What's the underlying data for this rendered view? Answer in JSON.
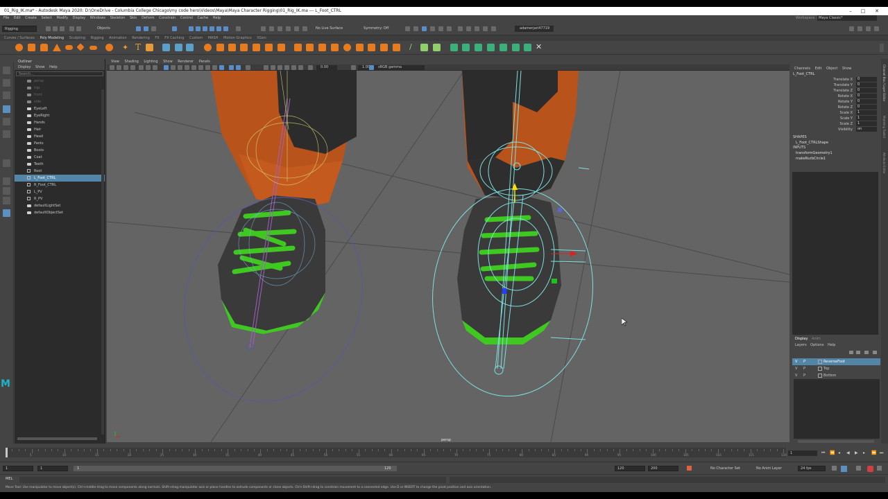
{
  "window": {
    "title": "01_Rig_IK.ma* - Autodesk Maya 2020: D:\\OneDrive - Columbia College Chicago\\my code hero\\Videos\\Maya\\Maya Character Rigging\\01_Rig_IK.ma  ---  L_Foot_CTRL",
    "min": "–",
    "max": "□",
    "close": "✕"
  },
  "menubar": [
    "File",
    "Edit",
    "Create",
    "Select",
    "Modify",
    "Display",
    "Windows",
    "Skeleton",
    "Skin",
    "Deform",
    "Constrain",
    "Control",
    "Cache",
    "Help"
  ],
  "workspace": {
    "label": "Workspace :",
    "value": "Maya Classic*"
  },
  "statusline": {
    "mode": "Rigging",
    "objects_label": "Objects",
    "live_surface": "No Live Surface",
    "symmetry": "Symmetry: Off",
    "user": "adamerjari47719"
  },
  "shelf_tabs": [
    "Curves / Surfaces",
    "Poly Modeling",
    "Sculpting",
    "Rigging",
    "Animation",
    "Rendering",
    "FX",
    "FX Caching",
    "Custom",
    "MASH",
    "Motion Graphics",
    "XGen"
  ],
  "shelf_active": "Poly Modeling",
  "outliner": {
    "title": "Outliner",
    "menu": [
      "Display",
      "Show",
      "Help"
    ],
    "search_placeholder": "Search...",
    "items": [
      {
        "label": "persp",
        "icon": "camera",
        "selected": false
      },
      {
        "label": "top",
        "icon": "camera",
        "selected": false
      },
      {
        "label": "front",
        "icon": "camera",
        "selected": false
      },
      {
        "label": "side",
        "icon": "camera",
        "selected": false
      },
      {
        "label": "EyeLeft",
        "icon": "mesh",
        "selected": false
      },
      {
        "label": "EyeRight",
        "icon": "mesh",
        "selected": false
      },
      {
        "label": "Hands",
        "icon": "mesh",
        "selected": false
      },
      {
        "label": "Hair",
        "icon": "mesh",
        "selected": false
      },
      {
        "label": "Head",
        "icon": "mesh",
        "selected": false
      },
      {
        "label": "Pants",
        "icon": "mesh",
        "selected": false
      },
      {
        "label": "Boots",
        "icon": "mesh",
        "selected": false
      },
      {
        "label": "Coat",
        "icon": "mesh",
        "selected": false
      },
      {
        "label": "Teeth",
        "icon": "mesh",
        "selected": false
      },
      {
        "label": "Root",
        "icon": "joint",
        "selected": false
      },
      {
        "label": "L_Foot_CTRL",
        "icon": "transform",
        "selected": true
      },
      {
        "label": "R_Foot_CTRL",
        "icon": "transform",
        "selected": false
      },
      {
        "label": "L_PV",
        "icon": "transform",
        "selected": false
      },
      {
        "label": "R_PV",
        "icon": "transform",
        "selected": false
      },
      {
        "label": "defaultLightSet",
        "icon": "set",
        "selected": false
      },
      {
        "label": "defaultObjectSet",
        "icon": "set",
        "selected": false
      }
    ]
  },
  "viewport": {
    "menu": [
      "View",
      "Shading",
      "Lighting",
      "Show",
      "Renderer",
      "Panels"
    ],
    "exposure": "0.00",
    "gamma": "1.00",
    "colorspace": "sRGB gamma",
    "camera_label": "persp"
  },
  "channel_box": {
    "menu": [
      "Channels",
      "Edit",
      "Object",
      "Show"
    ],
    "node": "L_Foot_CTRL",
    "attributes": [
      {
        "name": "Translate X",
        "value": "0"
      },
      {
        "name": "Translate Y",
        "value": "0"
      },
      {
        "name": "Translate Z",
        "value": "0"
      },
      {
        "name": "Rotate X",
        "value": "0"
      },
      {
        "name": "Rotate Y",
        "value": "0"
      },
      {
        "name": "Rotate Z",
        "value": "0"
      },
      {
        "name": "Scale X",
        "value": "1"
      },
      {
        "name": "Scale Y",
        "value": "1"
      },
      {
        "name": "Scale Z",
        "value": "1"
      },
      {
        "name": "Visibility",
        "value": "on"
      }
    ],
    "shapes_label": "SHAPES",
    "shapes": [
      "L_Foot_CTRLShape"
    ],
    "inputs_label": "INPUTS",
    "inputs": [
      "transformGeometry1",
      "makeNurbCircle1"
    ]
  },
  "side_tabs": [
    "Channel Box / Layer Editor",
    "Modeling Toolkit",
    "Attribute Editor"
  ],
  "layer_editor": {
    "tabs": [
      "Display",
      "Anim"
    ],
    "menu": [
      "Layers",
      "Options",
      "Help"
    ],
    "layers": [
      {
        "v": "V",
        "p": "P",
        "name": "ReverseFoot",
        "selected": true
      },
      {
        "v": "V",
        "p": "P",
        "name": "Top",
        "selected": false
      },
      {
        "v": "V",
        "p": "P",
        "name": "Bottom",
        "selected": false
      }
    ]
  },
  "timeslider": {
    "ticks": [
      "5",
      "10",
      "15",
      "20",
      "25",
      "30",
      "35",
      "40",
      "45",
      "50",
      "55",
      "60",
      "65",
      "70",
      "75",
      "80",
      "85",
      "90",
      "95",
      "100",
      "105",
      "110",
      "115",
      "120"
    ],
    "current_frame": "1"
  },
  "range": {
    "start": "1",
    "inner_start": "1",
    "bar_start": "1",
    "bar_end": "120",
    "end": "120",
    "outer_end": "200",
    "char_set": "No Character Set",
    "anim_layer": "No Anim Layer",
    "fps": "24 fps"
  },
  "command": {
    "lang": "MEL"
  },
  "help": "Move Tool: Use manipulator to move object(s). Ctrl+middle-drag to move components along normals. Shift+drag manipulator axis or plane handles to extrude components or clone objects. Ctrl+Shift+drag to constrain movement to a connected edge. Use D or INSERT to change the pivot position and axis orientation.",
  "logo": "M",
  "colors": {
    "selection": "#5285a6",
    "viewport_bg": "#646464",
    "pants": "#b8531c",
    "laces": "#3ec820",
    "wire": "#7ee0e0"
  }
}
